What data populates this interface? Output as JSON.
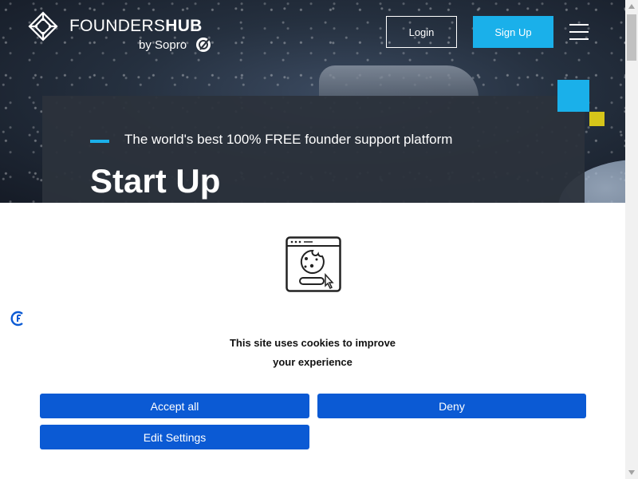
{
  "header": {
    "logo_light": "FOUNDERS",
    "logo_bold": "HUB",
    "logo_sub": "by Sopro",
    "login_label": "Login",
    "signup_label": "Sign Up"
  },
  "hero": {
    "tagline": "The world's best 100% FREE founder support platform",
    "title": "Start Up"
  },
  "cookie_banner": {
    "message_line1": "This site uses cookies to improve",
    "message_line2": "your experience",
    "accept_label": "Accept all",
    "deny_label": "Deny",
    "edit_label": "Edit Settings"
  },
  "colors": {
    "accent_cyan": "#1ab0ea",
    "accent_yellow": "#d6c51a",
    "cookie_button_blue": "#0b5ad4",
    "hero_card": "#2c323c"
  },
  "icons": [
    "foundershub-logo-icon",
    "sopro-icon",
    "hamburger-menu-icon",
    "cookie-browser-icon",
    "cookie-settings-icon"
  ]
}
